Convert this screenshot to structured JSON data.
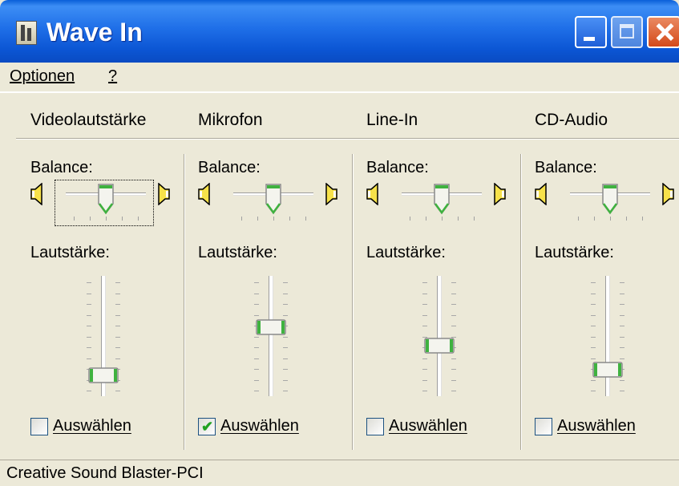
{
  "window": {
    "title": "Wave In"
  },
  "menu": {
    "items": [
      {
        "label": "Optionen"
      },
      {
        "label": "?"
      }
    ]
  },
  "channels": [
    {
      "name": "Videolautstärke",
      "balance_label": "Balance:",
      "volume_label": "Lautstärke:",
      "select_label": "Auswählen",
      "selected": false,
      "balance": 0.5,
      "volume": 0.1,
      "focused": true
    },
    {
      "name": "Mikrofon",
      "balance_label": "Balance:",
      "volume_label": "Lautstärke:",
      "select_label": "Auswählen",
      "selected": true,
      "balance": 0.5,
      "volume": 0.5,
      "focused": false
    },
    {
      "name": "Line-In",
      "balance_label": "Balance:",
      "volume_label": "Lautstärke:",
      "select_label": "Auswählen",
      "selected": false,
      "balance": 0.5,
      "volume": 0.35,
      "focused": false
    },
    {
      "name": "CD-Audio",
      "balance_label": "Balance:",
      "volume_label": "Lautstärke:",
      "select_label": "Auswählen",
      "selected": false,
      "balance": 0.5,
      "volume": 0.15,
      "focused": false
    }
  ],
  "status": {
    "text": "Creative Sound Blaster-PCI"
  },
  "colors": {
    "titlebar": "#0B55D3",
    "checkmark": "#21A121",
    "thumb_accent": "#3FB23F"
  },
  "icons": {
    "left_speaker": "speaker-left-icon",
    "right_speaker": "speaker-right-icon",
    "app": "mixer-icon"
  }
}
